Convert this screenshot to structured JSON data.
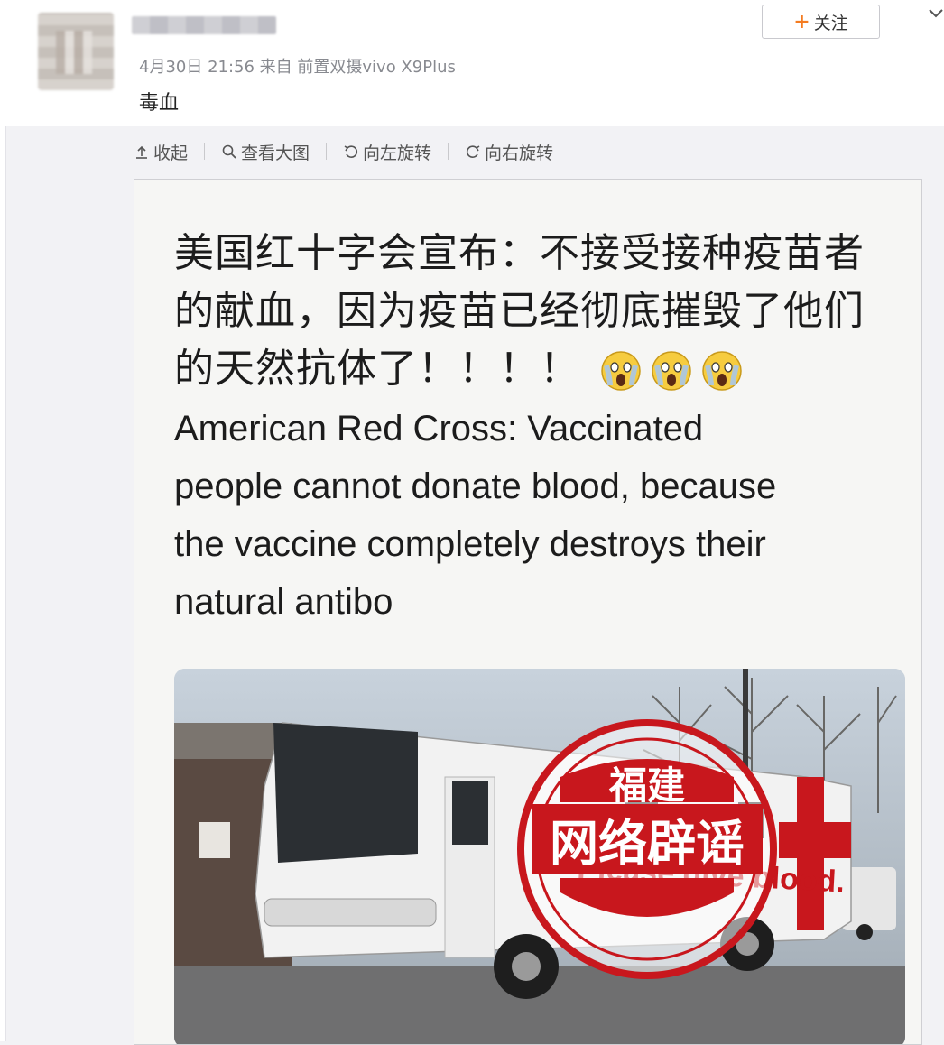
{
  "post": {
    "meta": "4月30日 21:56 来自 前置双摄vivo X9Plus",
    "text": "毒血",
    "follow_label": "关注",
    "follow_plus": "+"
  },
  "toolbar": {
    "collapse": "收起",
    "view_large": "查看大图",
    "rotate_left": "向左旋转",
    "rotate_right": "向右旋转"
  },
  "image": {
    "cn_line1": "美国红十字会宣布：不接受接种疫苗者",
    "cn_line2": "的献血，因为疫苗已经彻底摧毁了他们",
    "cn_line3": "的天然抗体了！！！！",
    "en_line1": "American Red Cross: Vaccinated",
    "en_line2": "people cannot donate blood, because",
    "en_line3": "the vaccine completely destroys their",
    "en_line4": "natural antibo",
    "bus_slogan": "Please give blood.",
    "stamp_top": "福建",
    "stamp_main": "网络辟谣"
  },
  "colors": {
    "stamp_red": "#c8171d",
    "follow_plus": "#f47b20",
    "meta_gray": "#888a90"
  },
  "icons": {
    "collapse": "arrow-up-icon",
    "view_large": "magnifier-icon",
    "rotate_left": "rotate-left-icon",
    "rotate_right": "rotate-right-icon",
    "chevron": "chevron-down-icon",
    "emoji": "screaming-face-icon"
  }
}
